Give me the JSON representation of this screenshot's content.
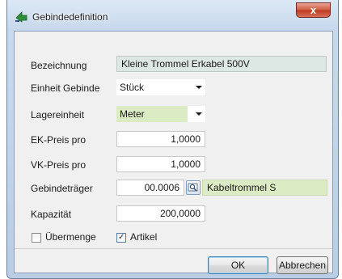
{
  "window": {
    "title": "Gebindedefinition",
    "close_label": "x",
    "title_icon": "arrow-icon"
  },
  "form": {
    "bezeichnung": {
      "label": "Bezeichnung",
      "value": "Kleine Trommel Erkabel 500V"
    },
    "einheit_gebinde": {
      "label": "Einheit Gebinde",
      "value": "Stück"
    },
    "lagereinheit": {
      "label": "Lagereinheit",
      "value": "Meter"
    },
    "ek_preis": {
      "label": "EK-Preis pro",
      "value": "1,0000"
    },
    "vk_preis": {
      "label": "VK-Preis pro",
      "value": "1,0000"
    },
    "gebindetraeger": {
      "label": "Gebindeträger",
      "code": "00.0006",
      "name": "Kabeltrommel S",
      "lookup_icon": "search-icon"
    },
    "kapazitaet": {
      "label": "Kapazität",
      "value": "200,0000"
    },
    "uebermenge": {
      "label": "Übermenge",
      "checked": false
    },
    "artikel": {
      "label": "Artikel",
      "checked": true
    }
  },
  "buttons": {
    "ok": "OK",
    "abbrechen": "Abbrechen"
  },
  "colors": {
    "readonly_field": "#dde8e4",
    "highlight_field": "#dbebc4",
    "close_button": "#c13c22"
  }
}
